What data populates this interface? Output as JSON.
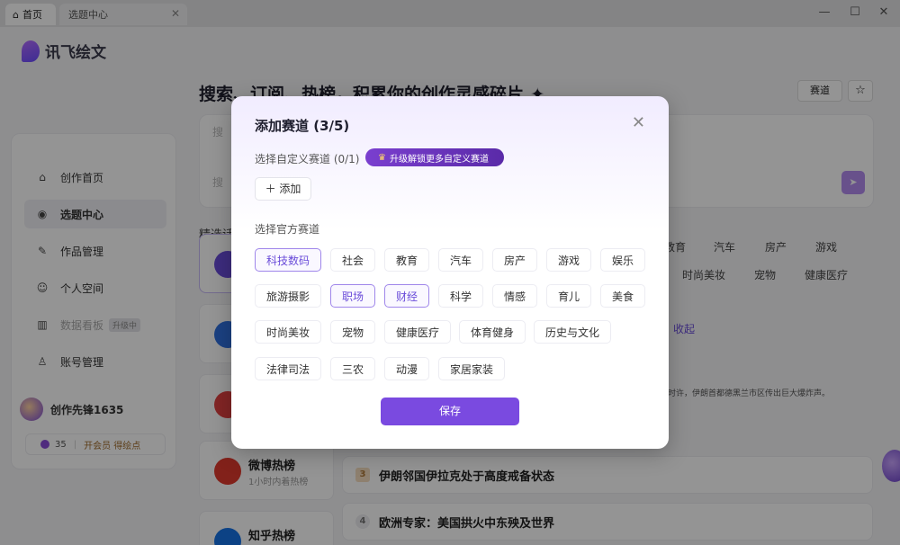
{
  "window": {
    "tabs": [
      {
        "label": "首页",
        "icon": "home-icon"
      },
      {
        "label": "选题中心",
        "close": "✕"
      }
    ],
    "controls": [
      "—",
      "☐",
      "✕"
    ]
  },
  "app": {
    "brand": "讯飞绘文",
    "headline": "搜索、订阅、热榜，积累你的创作灵感碎片",
    "headline_mark": ".✦",
    "track_button": "赛道",
    "star_button": "☆",
    "search_placeholder": "搜",
    "search_placeholder2": "搜",
    "send_icon": "➤",
    "picks_label": "精选话",
    "sidebar": {
      "items": [
        {
          "label": "创作首页",
          "icon": "⌂"
        },
        {
          "label": "选题中心",
          "icon": "◉"
        },
        {
          "label": "作品管理",
          "icon": "✎"
        },
        {
          "label": "个人空间",
          "icon": "☺"
        },
        {
          "label": "数据看板",
          "icon": "▥",
          "badge": "升级中"
        },
        {
          "label": "账号管理",
          "icon": "♙"
        }
      ],
      "username": "创作先锋1635",
      "points": "35",
      "vip": "开会员 得绘点"
    },
    "bg_tags_row1": [
      "教育",
      "汽车",
      "房产",
      "游戏"
    ],
    "bg_tags_row2": [
      "时尚美妆",
      "宠物",
      "健康医疗"
    ],
    "bg_collapse": "收起",
    "sources": [
      {
        "name": "",
        "sub": ""
      },
      {
        "name": "",
        "sub": ""
      },
      {
        "name": "",
        "sub": ""
      },
      {
        "name": "微博热榜",
        "sub": "1小时内着热榜"
      },
      {
        "name": "知乎热榜",
        "sub": ""
      }
    ],
    "hot_items": [
      {
        "rank": "3",
        "text": "伊朗邻国伊拉克处于高度戒备状态"
      },
      {
        "rank": "4",
        "text": "欧洲专家：美国拱火中东殃及世界"
      }
    ],
    "snippet": "时许，伊朗首都德黑兰市区传出巨大爆炸声。"
  },
  "modal": {
    "title": "添加赛道 (3/5)",
    "close_icon": "✕",
    "custom_label": "选择自定义赛道 (0/1)",
    "upgrade_label": "升级解锁更多自定义赛道",
    "crown_icon": "♛",
    "add_label": "＋ 添加",
    "official_label": "选择官方赛道",
    "save_label": "保存",
    "chips": [
      {
        "label": "科技数码",
        "selected": true
      },
      {
        "label": "社会",
        "selected": false
      },
      {
        "label": "教育",
        "selected": false
      },
      {
        "label": "汽车",
        "selected": false
      },
      {
        "label": "房产",
        "selected": false
      },
      {
        "label": "游戏",
        "selected": false
      },
      {
        "label": "娱乐",
        "selected": false
      },
      {
        "label": "旅游摄影",
        "selected": false
      },
      {
        "label": "职场",
        "selected": true
      },
      {
        "label": "财经",
        "selected": true
      },
      {
        "label": "科学",
        "selected": false
      },
      {
        "label": "情感",
        "selected": false
      },
      {
        "label": "育儿",
        "selected": false
      },
      {
        "label": "美食",
        "selected": false
      },
      {
        "label": "时尚美妆",
        "selected": false
      },
      {
        "label": "宠物",
        "selected": false
      },
      {
        "label": "健康医疗",
        "selected": false
      },
      {
        "label": "体育健身",
        "selected": false
      },
      {
        "label": "历史与文化",
        "selected": false
      },
      {
        "label": "法律司法",
        "selected": false
      },
      {
        "label": "三农",
        "selected": false
      },
      {
        "label": "动漫",
        "selected": false
      },
      {
        "label": "家居家装",
        "selected": false
      }
    ]
  }
}
